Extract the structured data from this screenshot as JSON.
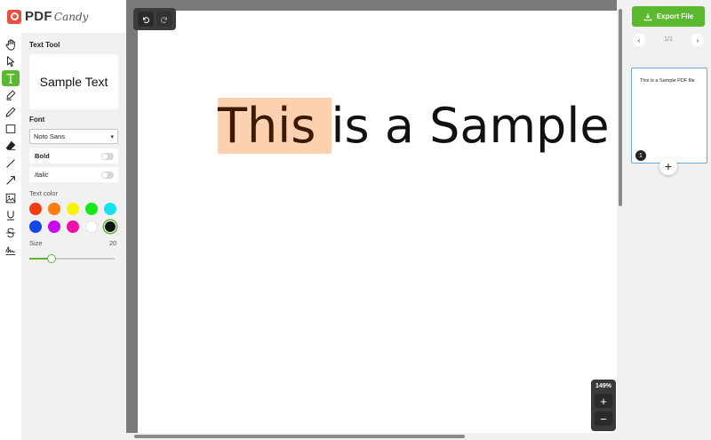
{
  "logo": {
    "pdf": "PDF",
    "candy": "Candy"
  },
  "tools": [
    {
      "name": "hand",
      "label": "hand-icon"
    },
    {
      "name": "select",
      "label": "pointer-icon"
    },
    {
      "name": "text",
      "label": "text-icon",
      "active": true
    },
    {
      "name": "marker",
      "label": "marker-icon"
    },
    {
      "name": "pencil",
      "label": "pencil-icon"
    },
    {
      "name": "rectangle",
      "label": "rectangle-icon"
    },
    {
      "name": "eraser",
      "label": "eraser-icon"
    },
    {
      "name": "line",
      "label": "line-icon"
    },
    {
      "name": "arrow",
      "label": "arrow-icon"
    },
    {
      "name": "image",
      "label": "image-icon"
    },
    {
      "name": "underline",
      "label": "underline-icon"
    },
    {
      "name": "strikethrough",
      "label": "strikethrough-icon"
    },
    {
      "name": "signature",
      "label": "signature-icon"
    }
  ],
  "text_tool": {
    "title": "Text Tool",
    "preview": "Sample Text",
    "font_label": "Font",
    "font_value": "Noto Sans",
    "bold_label": "Bold",
    "bold_on": false,
    "italic_label": "Italic",
    "italic_on": false,
    "color_label": "Text color",
    "colors": [
      "#f03c13",
      "#ff7d0f",
      "#f5f50a",
      "#19e619",
      "#18e1f0",
      "#1448e6",
      "#c80aec",
      "#f010a8",
      "#ffffff",
      "#111111"
    ],
    "selected_color": "#111111",
    "size_label": "Size",
    "size_value": "20",
    "size_fraction": 0.26
  },
  "canvas": {
    "text_highlighted": "This ",
    "text_rest": "is a Sample PDF",
    "highlight_color": "#fbd1b0",
    "zoom": "149%",
    "zoom_in": "+",
    "zoom_out": "−"
  },
  "sidebar": {
    "export_label": "Export File",
    "page_indicator": "1/1",
    "prev": "‹",
    "next": "›",
    "thumb_text": "This is a Sample PDF file",
    "thumb_number": "1",
    "add_page": "+"
  },
  "colors": {
    "accent": "#5cb82e",
    "canvas_bg": "#7a7a7a",
    "panel_bg": "#f1f1f1"
  }
}
